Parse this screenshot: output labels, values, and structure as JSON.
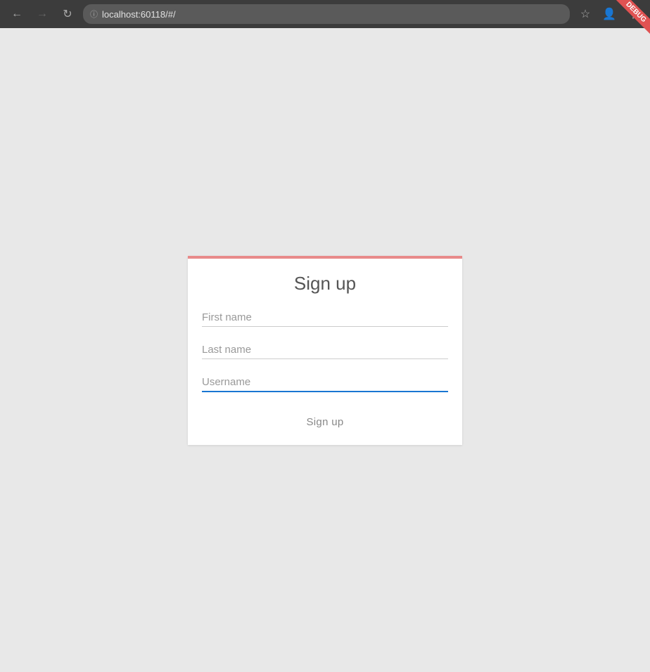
{
  "browser": {
    "url": "localhost:60118/#/",
    "back_disabled": false,
    "forward_disabled": true
  },
  "debug_ribbon": {
    "label": "DEBUG"
  },
  "form": {
    "title": "Sign up",
    "first_name_placeholder": "First name",
    "last_name_placeholder": "Last name",
    "username_placeholder": "Username",
    "submit_label": "Sign up"
  }
}
